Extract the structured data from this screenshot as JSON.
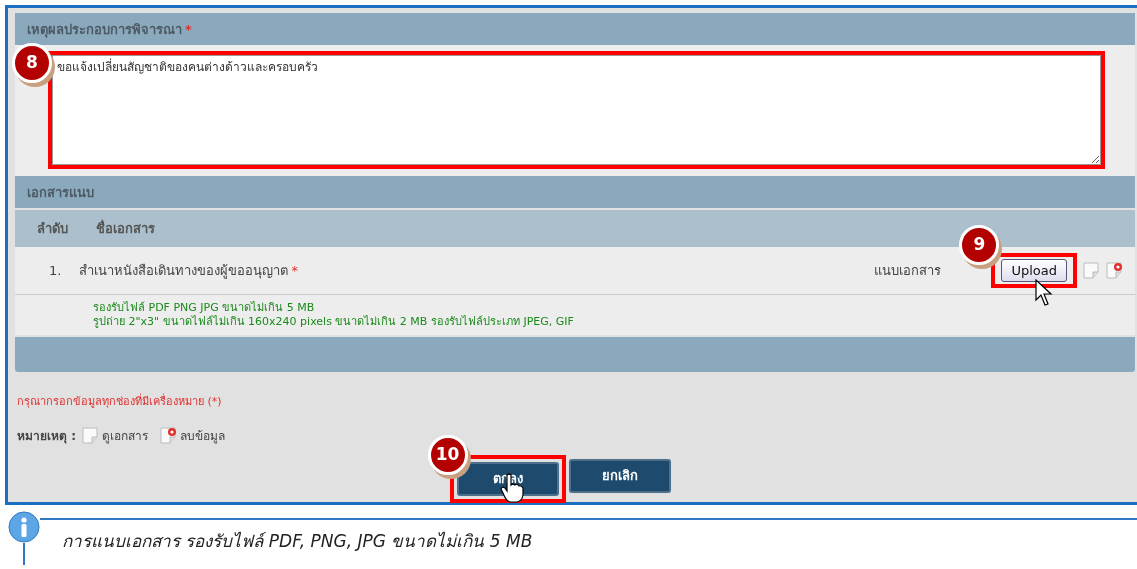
{
  "reason_section": {
    "title": "เหตุผลประกอบการพิจารณา",
    "required_mark": "*",
    "value": "ขอแจ้งเปลี่ยนสัญชาติของคนต่างด้าวและครอบครัว",
    "callout": "8"
  },
  "attachments": {
    "title": "เอกสารแนบ",
    "columns": [
      "ลำดับ",
      "ชื่อเอกสาร"
    ],
    "rows": [
      {
        "index": "1.",
        "name": "สำเนาหนังสือเดินทางของผู้ขออนุญาต",
        "required_mark": "*",
        "action_label": "แนบเอกสาร",
        "button": "Upload",
        "callout": "9"
      }
    ],
    "notes": [
      "รองรับไฟล์ PDF PNG JPG ขนาดไม่เกิน 5 MB",
      "รูปถ่าย 2\"x3\" ขนาดไฟล์ไม่เกิน 160x240 pixels ขนาดไม่เกิน 2 MB รองรับไฟล์ประเภท JPEG, GIF"
    ]
  },
  "required_note": "กรุณากรอกข้อมูลทุกช่องที่มีเครื่องหมาย (*)",
  "legend": {
    "label": "หมายเหตุ :",
    "items": [
      {
        "kind": "view",
        "text": "ดูเอกสาร"
      },
      {
        "kind": "delete",
        "text": "ลบข้อมูล"
      }
    ]
  },
  "buttons": [
    {
      "label": "ตกลง",
      "callout": "10"
    },
    {
      "label": "ยกเลิก"
    }
  ],
  "info": "การแนบเอกสาร รองรับไฟล์ PDF, PNG, JPG ขนาดไม่เกิน 5 MB"
}
